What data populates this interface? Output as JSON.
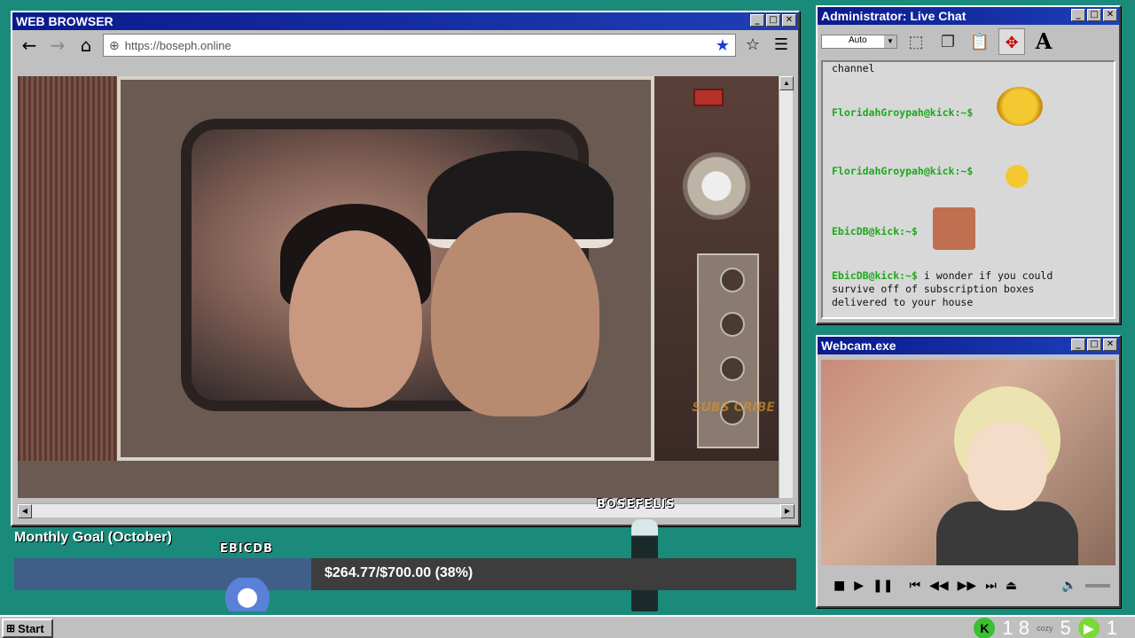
{
  "browser": {
    "title": "WEB BROWSER",
    "url": "https://boseph.online",
    "video_watermark": "SUBS CRIBE"
  },
  "chat": {
    "title": "Administrator: Live Chat",
    "font_size_select": "Auto",
    "messages": [
      {
        "user": "",
        "text": "channel"
      },
      {
        "user": "FloridahGroypah@kick:~$",
        "text": ""
      },
      {
        "user": "FloridahGroypah@kick:~$",
        "text": ""
      },
      {
        "user": "EbicDB@kick:~$",
        "text": ""
      },
      {
        "user": "EbicDB@kick:~$",
        "text": "i wonder if you could survive off of subscription boxes delivered to your house"
      }
    ]
  },
  "webcam": {
    "title": "Webcam.exe"
  },
  "goal": {
    "title": "Monthly Goal (October)",
    "text": "$264.77/$700.00 (38%)",
    "progress": 0.38
  },
  "overlay": {
    "player1": "EBICDB",
    "player2": "BOSEFELIS"
  },
  "taskbar": {
    "start": "Start",
    "tray_num1": "1 8",
    "tray_label": "cozy",
    "tray_num2": "5",
    "tray_num3": "1"
  },
  "colors": {
    "desktop": "#1a8a7a",
    "titlebar": "#0a1a8c",
    "chat_user": "#1ea81e",
    "goal_fill": "#3f5f8a"
  }
}
